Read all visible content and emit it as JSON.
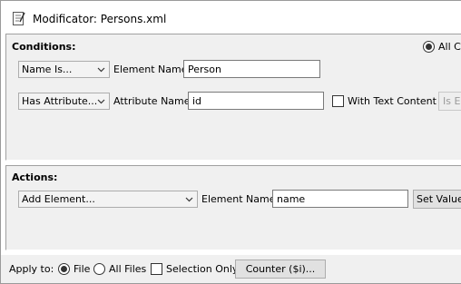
{
  "window": {
    "title": "Modificator: Persons.xml"
  },
  "conditions": {
    "header": "Conditions:",
    "all_radio_label": "All C",
    "row1": {
      "combo": "Name Is...",
      "field_label": "Element Name:",
      "field_value": "Person"
    },
    "row2": {
      "combo": "Has Attribute...",
      "field_label": "Attribute Name:",
      "field_value": "id",
      "checkbox_label": "With Text Content",
      "button_label": "Is E"
    }
  },
  "actions": {
    "header": "Actions:",
    "combo": "Add Element...",
    "field_label": "Element Name:",
    "field_value": "name",
    "button_label": "Set Value"
  },
  "bottom": {
    "apply_to_label": "Apply to:",
    "file_label": "File",
    "all_files_label": "All Files",
    "selection_only_label": "Selection Only",
    "counter_button": "Counter ($i)..."
  }
}
